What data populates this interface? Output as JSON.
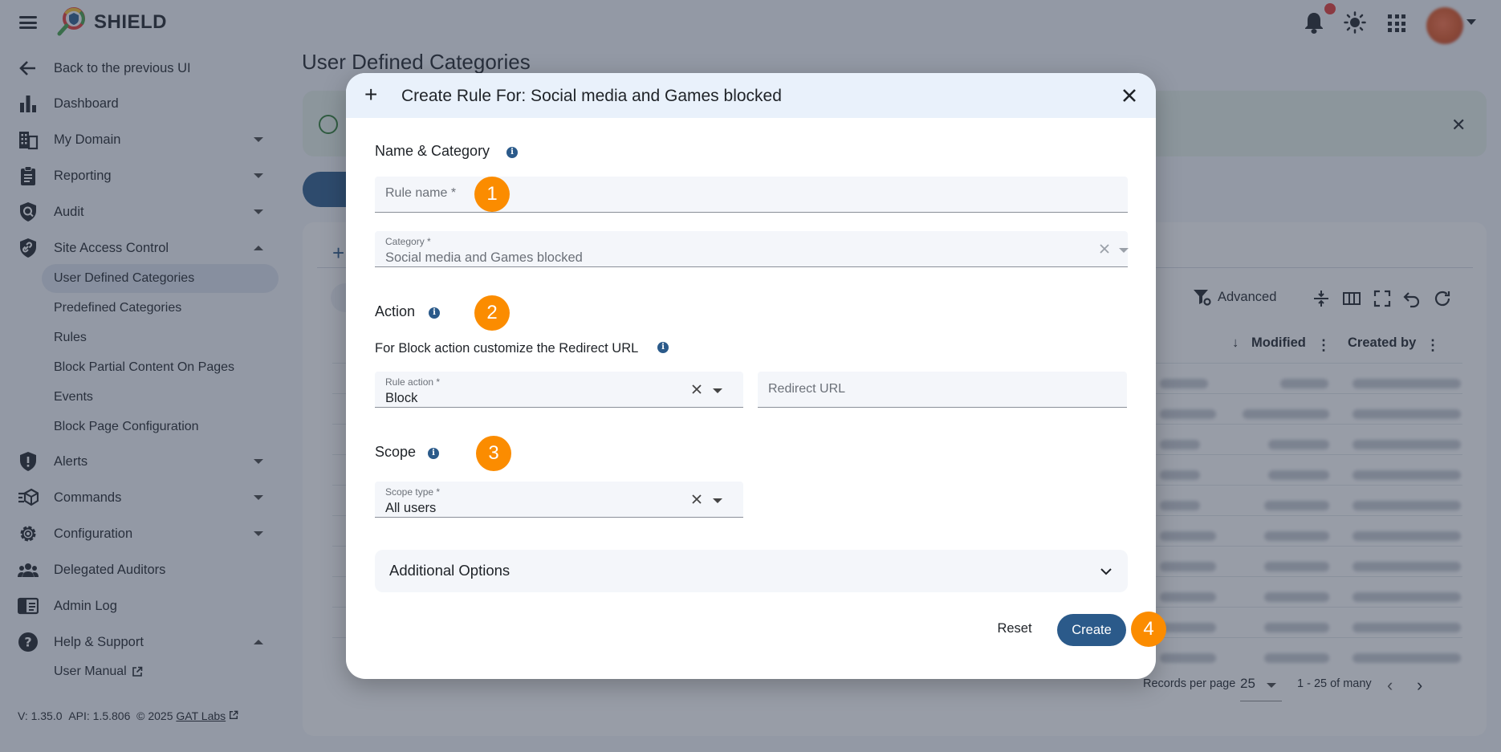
{
  "app": {
    "brand": "SHIELD"
  },
  "sidebar": {
    "back": "Back to the previous UI",
    "items": [
      {
        "label": "Dashboard",
        "icon": "bar-chart-icon"
      },
      {
        "label": "My Domain",
        "icon": "building-icon"
      },
      {
        "label": "Reporting",
        "icon": "clipboard-icon"
      },
      {
        "label": "Audit",
        "icon": "shield-search-icon"
      },
      {
        "label": "Site Access Control",
        "icon": "shield-link-icon"
      }
    ],
    "site_access_sub": [
      "User Defined Categories",
      "Predefined Categories",
      "Rules",
      "Block Partial Content On Pages",
      "Events",
      "Block Page Configuration"
    ],
    "items2": [
      {
        "label": "Alerts",
        "icon": "shield-alert-icon"
      },
      {
        "label": "Commands",
        "icon": "commands-icon"
      },
      {
        "label": "Configuration",
        "icon": "gear-icon"
      },
      {
        "label": "Delegated Auditors",
        "icon": "people-icon"
      },
      {
        "label": "Admin Log",
        "icon": "log-book-icon"
      },
      {
        "label": "Help & Support",
        "icon": "help-icon"
      }
    ],
    "help_sub": [
      "User Manual"
    ],
    "version": "V: 1.35.0",
    "api": "API: 1.5.806",
    "copyright": "© 2025",
    "company": "GAT Labs"
  },
  "main": {
    "title": "User Defined Categories",
    "advanced": "Advanced",
    "columns": {
      "modified": "Modified",
      "created_by": "Created by"
    },
    "records_per_page_label": "Records per page",
    "records_per_page": "25",
    "range": "1 - 25 of many"
  },
  "modal": {
    "title": "Create Rule For: Social media and Games blocked",
    "sections": {
      "name_category": "Name & Category",
      "action": "Action",
      "action_helper": "For Block action customize the Redirect URL",
      "scope": "Scope"
    },
    "fields": {
      "rule_name_placeholder": "Rule name *",
      "category_label": "Category *",
      "category_value": "Social media and Games blocked",
      "rule_action_label": "Rule action *",
      "rule_action_value": "Block",
      "redirect_placeholder": "Redirect URL",
      "scope_label": "Scope type *",
      "scope_value": "All users"
    },
    "additional_options": "Additional Options",
    "reset": "Reset",
    "create": "Create"
  },
  "badges": [
    "1",
    "2",
    "3",
    "4"
  ],
  "colors": {
    "primary": "#2b5a8a",
    "badge": "#fb8c00",
    "notification": "#e53935"
  }
}
